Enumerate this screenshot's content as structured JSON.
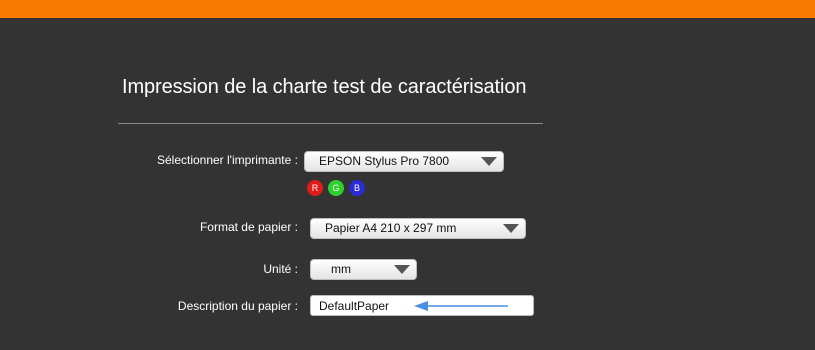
{
  "colors": {
    "top_bar": "#f97a00",
    "background": "#333333",
    "arrow": "#4a8fe0",
    "channel_r": "#e11b1b",
    "channel_g": "#2ed02e",
    "channel_b": "#2a2ad6"
  },
  "page": {
    "title": "Impression de la charte test de caractérisation"
  },
  "printer": {
    "label": "Sélectionner l'imprimante :",
    "selected": "EPSON Stylus Pro 7800",
    "channels": [
      "R",
      "G",
      "B"
    ]
  },
  "paper_format": {
    "label": "Format de papier :",
    "selected": "Papier A4 210 x 297 mm"
  },
  "unit": {
    "label": "Unité :",
    "selected": "mm"
  },
  "paper_description": {
    "label": "Description du papier :",
    "value": "DefaultPaper"
  }
}
